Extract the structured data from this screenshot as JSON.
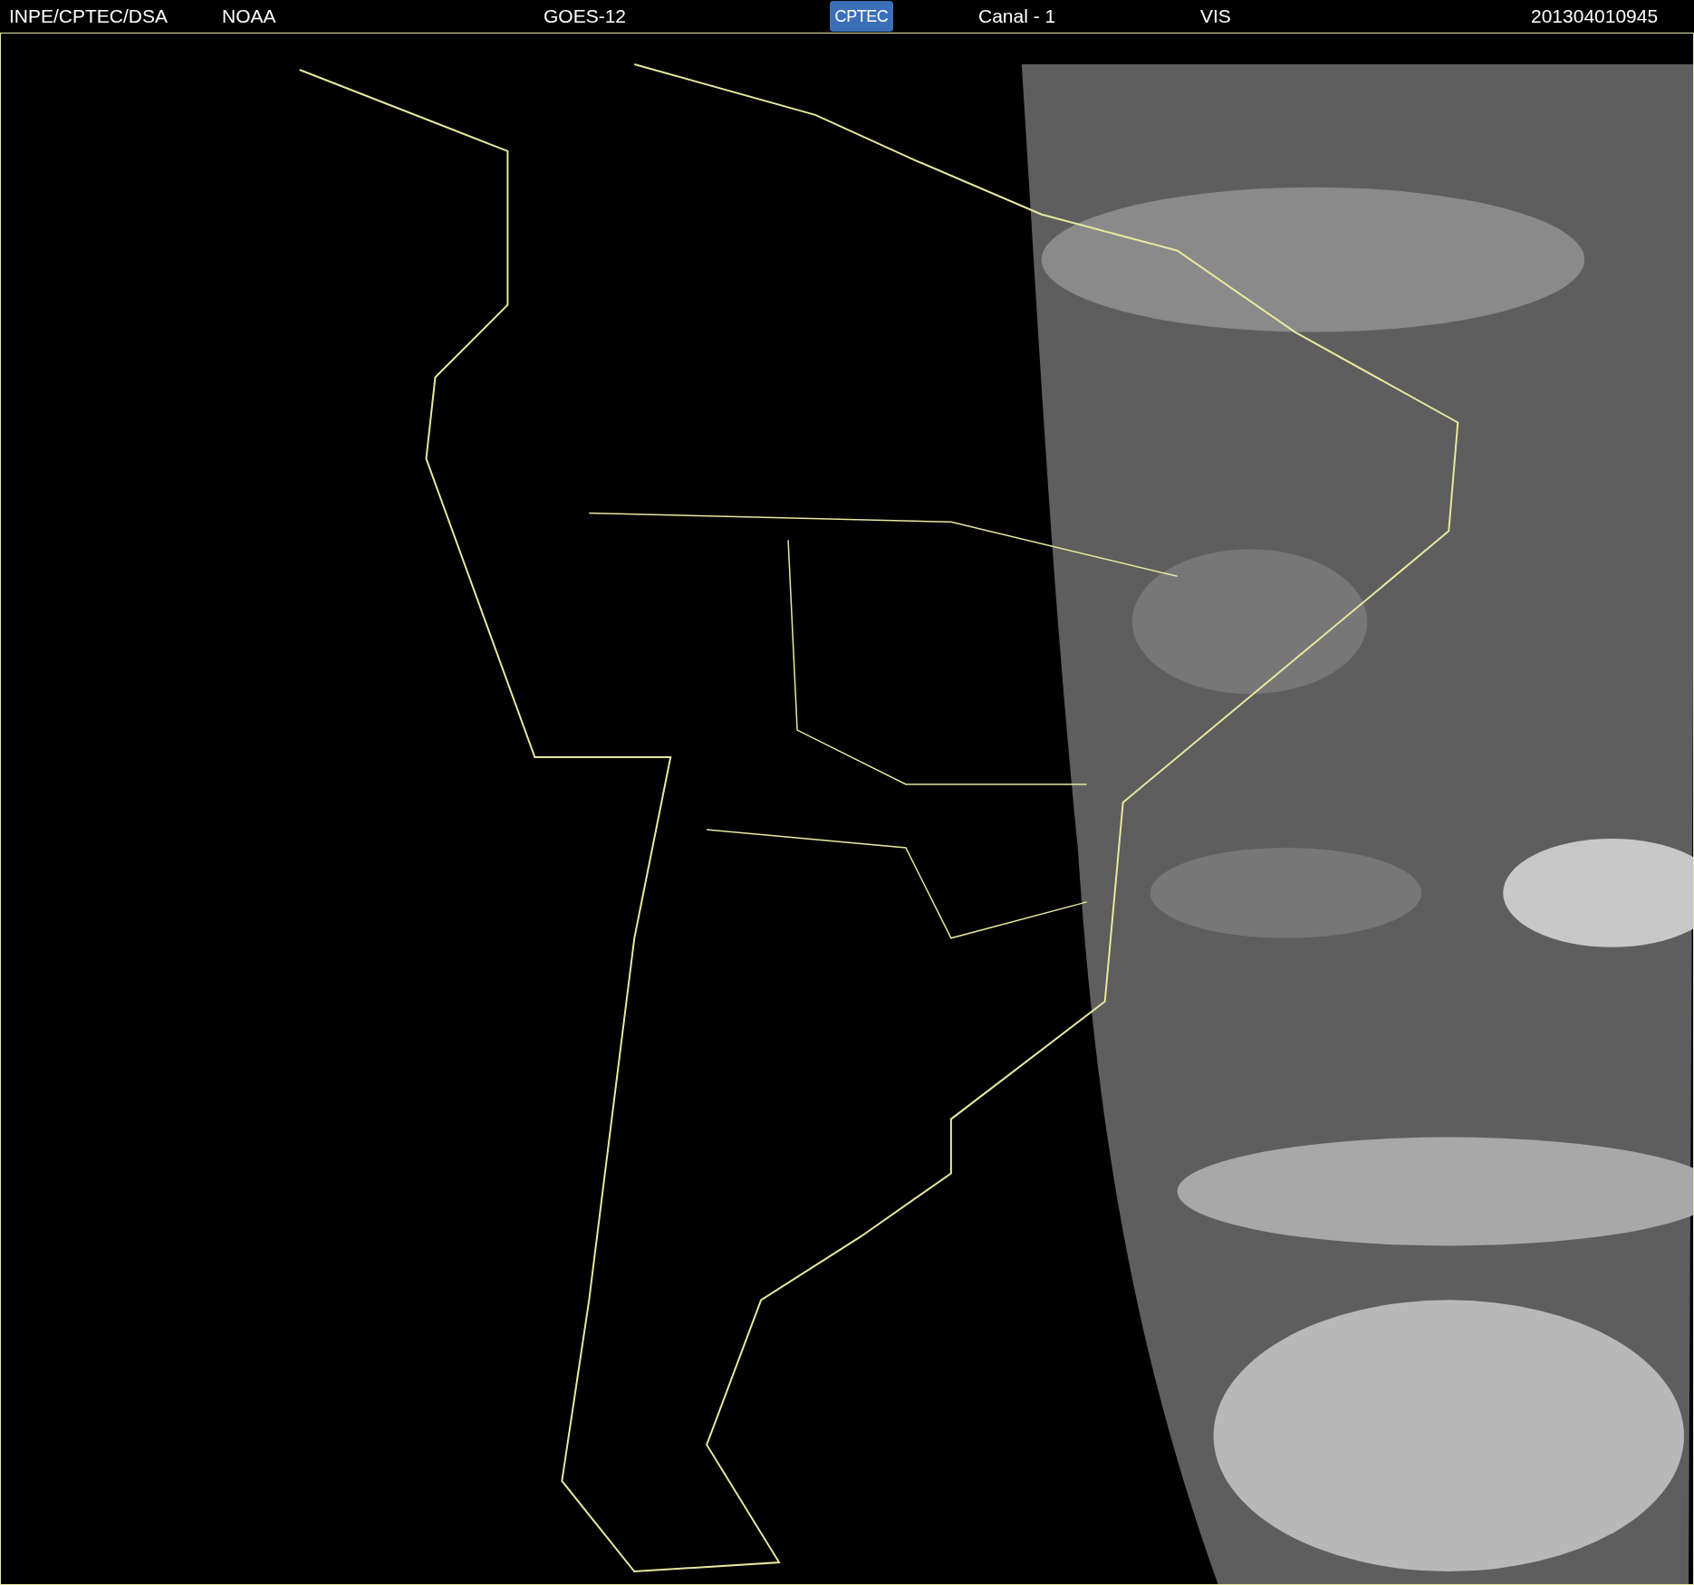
{
  "header": {
    "source": "INPE/CPTEC/DSA",
    "agency": "NOAA",
    "satellite": "GOES-12",
    "logo": "CPTEC",
    "channel": "Canal - 1",
    "band": "VIS",
    "timestamp": "201304010945"
  }
}
